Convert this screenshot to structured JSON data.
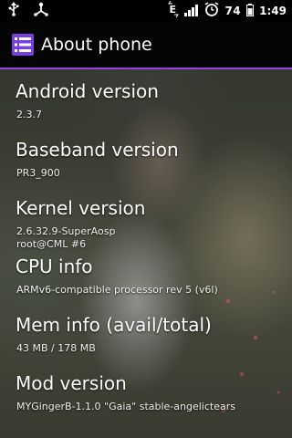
{
  "statusbar": {
    "left_icons": [
      "usb-icon",
      "android-debug-icon"
    ],
    "right_icons": [
      "network-e-icon",
      "signal-icon",
      "alarm-icon",
      "battery-icon"
    ],
    "battery_percent": "74",
    "time": "1:49"
  },
  "titlebar": {
    "icon": "settings-list-icon",
    "title": "About phone",
    "accent_color": "#9a3fe0"
  },
  "items": [
    {
      "title": "Android version",
      "summary": [
        "2.3.7"
      ]
    },
    {
      "title": "Baseband version",
      "summary": [
        "PR3_900"
      ]
    },
    {
      "title": "Kernel version",
      "summary": [
        "2.6.32.9-SuperAosp",
        "root@CML #6"
      ]
    },
    {
      "title": "CPU info",
      "summary": [
        "ARMv6-compatible processor rev 5 (v6l)"
      ]
    },
    {
      "title": "Mem info (avail/total)",
      "summary": [
        "43 MB / 178 MB"
      ]
    },
    {
      "title": "Mod version",
      "summary": [
        "MYGingerB-1.1.0 \"Gaia\" stable-angelictears"
      ]
    }
  ]
}
